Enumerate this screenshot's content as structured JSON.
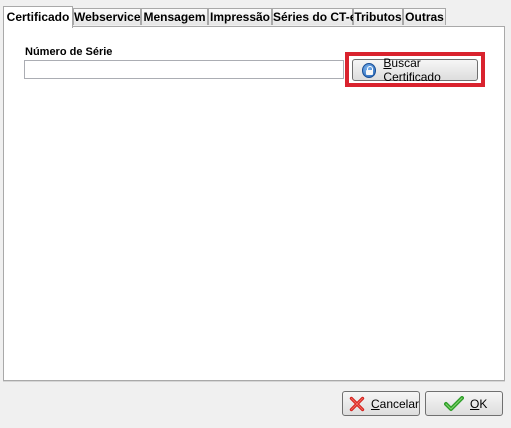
{
  "tabs": [
    {
      "label": "Certificado",
      "active": true
    },
    {
      "label": "Webservice"
    },
    {
      "label": "Mensagem"
    },
    {
      "label": "Impressão"
    },
    {
      "label": "Séries do CT-e"
    },
    {
      "label": "Tributos"
    },
    {
      "label": "Outras"
    }
  ],
  "certificado": {
    "serial_label": "Número de Série",
    "serial_value": "",
    "search_button": {
      "underline": "B",
      "rest": "uscar Certificado"
    }
  },
  "footer": {
    "cancel": {
      "underline": "C",
      "rest": "ancelar"
    },
    "ok": {
      "underline": "O",
      "rest": "K"
    }
  },
  "colors": {
    "highlight": "#d9232e",
    "cancel_icon": "#d4201c",
    "ok_icon": "#2f9e2b"
  },
  "icons": {
    "search": "lock-icon",
    "cancel": "cancel-x-icon",
    "ok": "checkmark-icon"
  }
}
